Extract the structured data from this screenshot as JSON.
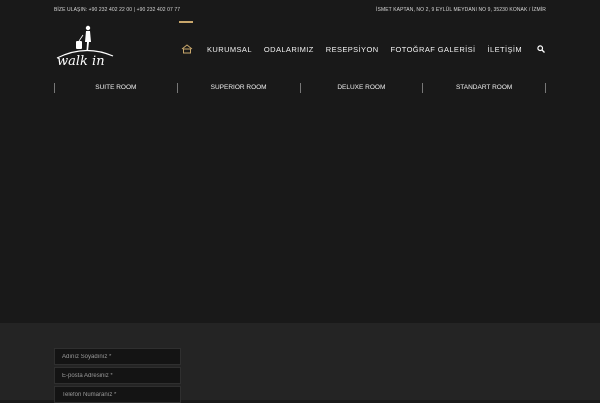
{
  "topbar": {
    "contact": "BİZE ULAŞIN: +90 232 402 22 00 | +90 232 402 07 77",
    "address": "İSMET KAPTAN, NO 2, 9 EYLÜL MEYDANI NO 9, 35230 KONAK / İZMİR"
  },
  "logo": {
    "text": "walk in"
  },
  "nav": {
    "items": [
      "KURUMSAL",
      "ODALARIMIZ",
      "RESEPSİYON",
      "FOTOĞRAF GALERİSİ",
      "İLETİŞİM"
    ],
    "accent_color": "#c8a66b",
    "home_icon": "home-icon",
    "search_icon": "search-icon"
  },
  "rooms": [
    "SUITE ROOM",
    "SUPERIOR ROOM",
    "DELUXE ROOM",
    "STANDART ROOM"
  ],
  "form": {
    "name_placeholder": "Adınız Soyadınız *",
    "email_placeholder": "E-posta Adresiniz *",
    "phone_placeholder": "Telefon Numaranız *"
  }
}
